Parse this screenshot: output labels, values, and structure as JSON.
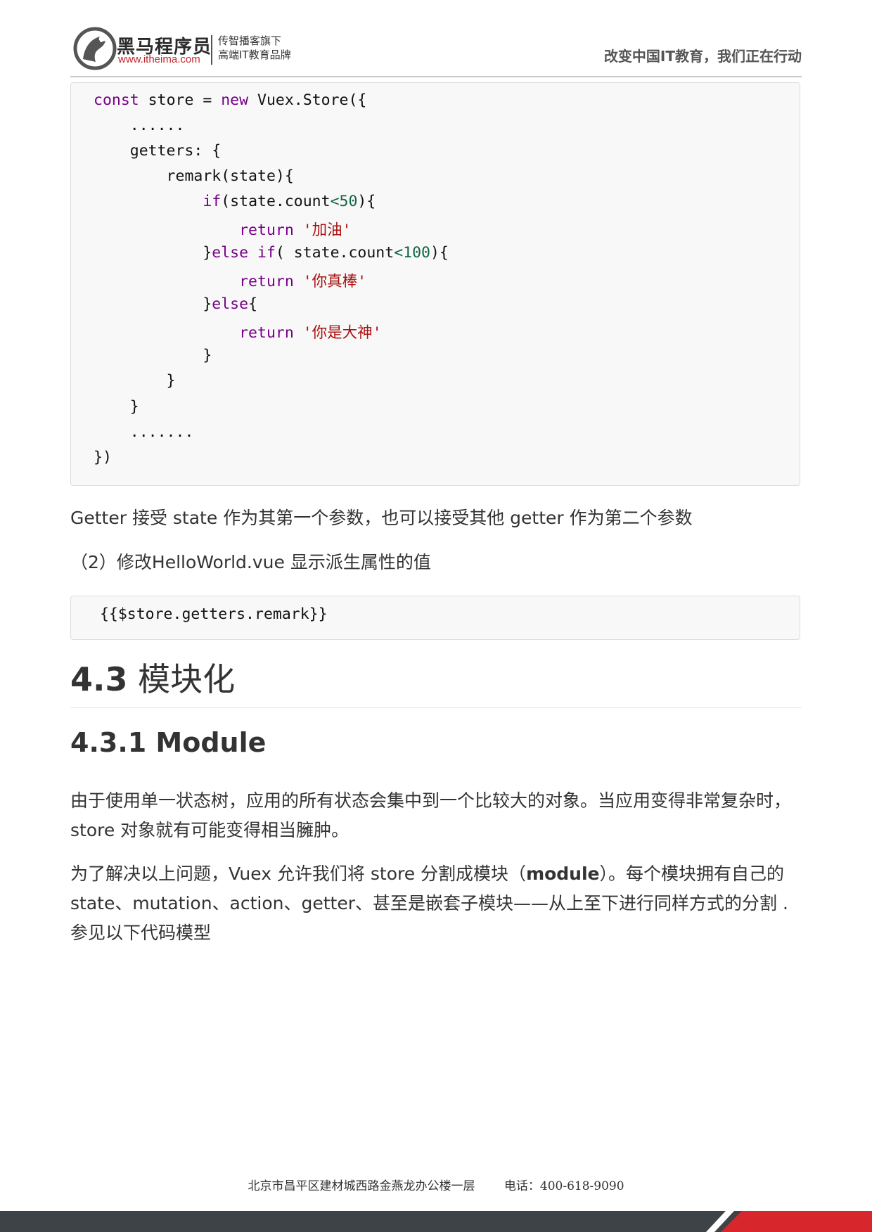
{
  "header": {
    "brand_name": "黑马程序员",
    "brand_url": "www.itheima.com",
    "brand_sub1": "传智播客旗下",
    "brand_sub2": "高端IT教育品牌",
    "slogan": "改变中国IT教育，我们正在行动"
  },
  "code_main": {
    "l1_a": "const",
    "l1_b": " store = ",
    "l1_c": "new",
    "l1_d": " Vuex.Store({",
    "l2": "    ......",
    "l3": "    getters: {",
    "l4": "        remark(state){",
    "l5_indent": "            ",
    "l5_kw": "if",
    "l5_a": "(state.count",
    "l5_op": "<",
    "l5_num": "50",
    "l5_b": "){",
    "l6_indent": "                ",
    "l6_kw": "return",
    "l6_sp": " ",
    "l6_str": "'加油'",
    "l7_a": "            }",
    "l7_kw1": "else",
    "l7_sp": " ",
    "l7_kw2": "if",
    "l7_b": "( state.count",
    "l7_op": "<",
    "l7_num": "100",
    "l7_c": "){",
    "l8_indent": "                ",
    "l8_kw": "return",
    "l8_sp": " ",
    "l8_str": "'你真棒'",
    "l9_a": "            }",
    "l9_kw": "else",
    "l9_b": "{",
    "l10_indent": "                ",
    "l10_kw": "return",
    "l10_sp": " ",
    "l10_str": "'你是大神'",
    "l11": "            }",
    "l12": "        }",
    "l13": "    }",
    "l14": "    .......",
    "l15": "})"
  },
  "para1": "Getter 接受 state 作为其第一个参数，也可以接受其他 getter 作为第二个参数",
  "para2": "（2）修改HelloWorld.vue  显示派生属性的值",
  "code_small": " {{$store.getters.remark}}",
  "section": {
    "number": "4.3",
    "title": " 模块化"
  },
  "subsection": "4.3.1 Module",
  "para3": "由于使用单一状态树，应用的所有状态会集中到一个比较大的对象。当应用变得非常复杂时，store 对象就有可能变得相当臃肿。",
  "para4_a": "为了解决以上问题，Vuex 允许我们将 store 分割成模块（",
  "para4_bold": "module",
  "para4_b": "）。每个模块拥有自己的 state、mutation、action、getter、甚至是嵌套子模块——从上至下进行同样方式的分割 .参见以下代码模型",
  "footer": {
    "address": "北京市昌平区建材城西路金燕龙办公楼一层",
    "phone": "电话：400-618-9090"
  }
}
